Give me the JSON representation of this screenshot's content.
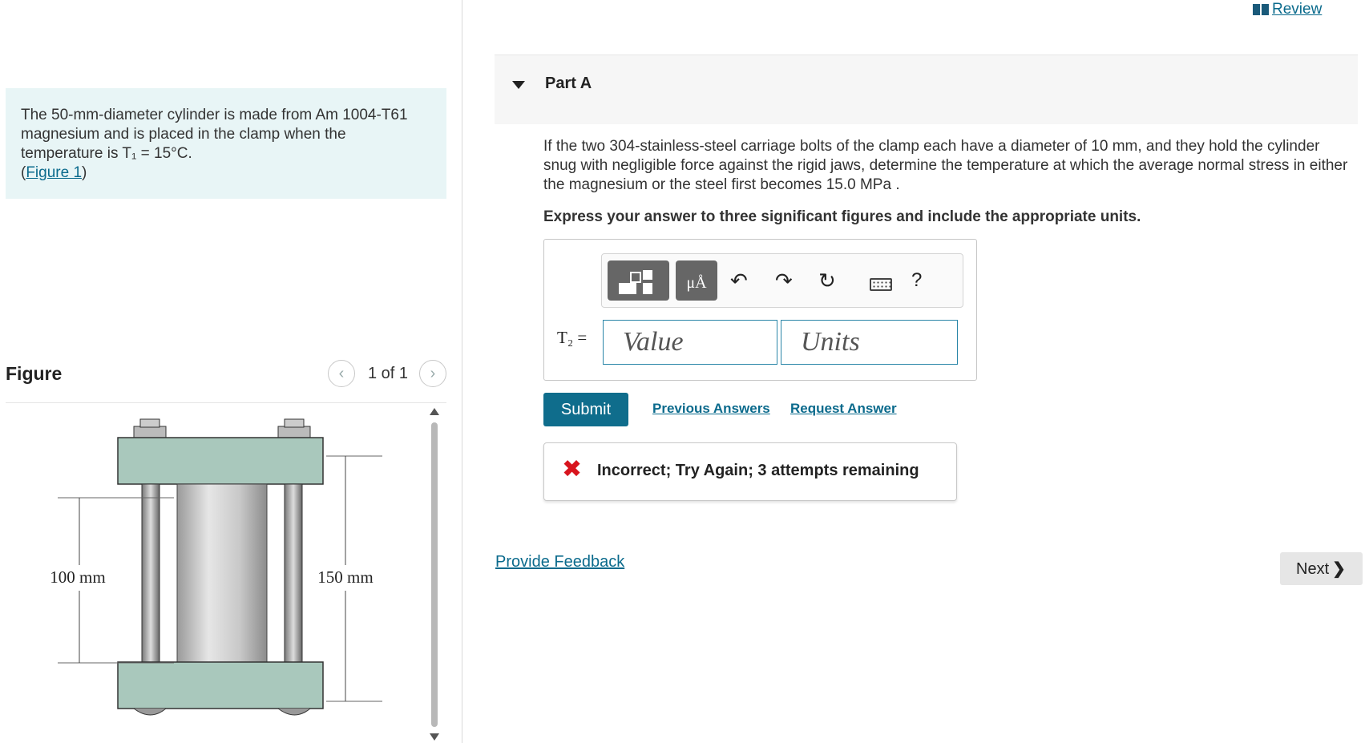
{
  "header": {
    "review_label": "Review"
  },
  "intro": {
    "text": "The 50-mm-diameter cylinder is made from Am 1004-T61 magnesium and is placed in the clamp when the temperature is T₁ = 15°C.",
    "figure_link": "Figure 1"
  },
  "figure": {
    "title": "Figure",
    "pager_text": "1 of 1",
    "dim_left": "100 mm",
    "dim_right": "150 mm"
  },
  "part": {
    "title": "Part A",
    "question": "If the two 304-stainless-steel carriage bolts of the clamp each have a diameter of 10 mm, and they hold the cylinder snug with negligible force against the rigid jaws, determine the temperature at which the average normal stress in either the magnesium or the steel first becomes 15.0 MPa .",
    "instruction": "Express your answer to three significant figures and include the appropriate units."
  },
  "answer": {
    "variable_label": "T₂ =",
    "units_button_label": "μÅ",
    "help_label": "?",
    "value_placeholder": "Value",
    "units_placeholder": "Units"
  },
  "actions": {
    "submit_label": "Submit",
    "previous_answers_label": "Previous Answers",
    "request_answer_label": "Request Answer"
  },
  "feedback": {
    "message": "Incorrect; Try Again; 3 attempts remaining"
  },
  "footer": {
    "provide_feedback_label": "Provide Feedback",
    "next_label": "Next"
  },
  "colors": {
    "accent": "#0f6d8c",
    "error": "#d8141e",
    "intro_bg": "#e8f5f6"
  },
  "icons": [
    "book-icon",
    "chevron-left-icon",
    "chevron-right-icon",
    "caret-down-icon",
    "templates-icon",
    "units-icon",
    "undo-icon",
    "redo-icon",
    "reset-icon",
    "keyboard-icon",
    "help-icon",
    "x-icon",
    "chevron-right-icon"
  ]
}
